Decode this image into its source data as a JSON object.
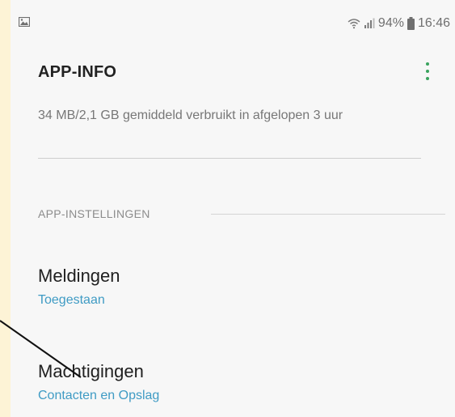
{
  "status_bar": {
    "battery": "94%",
    "time": "16:46",
    "icons": [
      "image-icon",
      "wifi-icon",
      "signal-icon",
      "battery-icon"
    ]
  },
  "app_bar": {
    "title": "APP-INFO",
    "menu_icon": "overflow-menu-icon"
  },
  "usage": {
    "text": "34 MB/2,1 GB gemiddeld verbruikt in afgelopen 3 uur"
  },
  "section": {
    "header": "APP-INSTELLINGEN"
  },
  "preferences": [
    {
      "title": "Meldingen",
      "subtitle": "Toegestaan"
    },
    {
      "title": "Machtigingen",
      "subtitle": "Contacten en Opslag"
    }
  ],
  "colors": {
    "accent": "#3aa35e",
    "link": "#3f9bc4",
    "highlight_strip": "#fdf3d6"
  }
}
